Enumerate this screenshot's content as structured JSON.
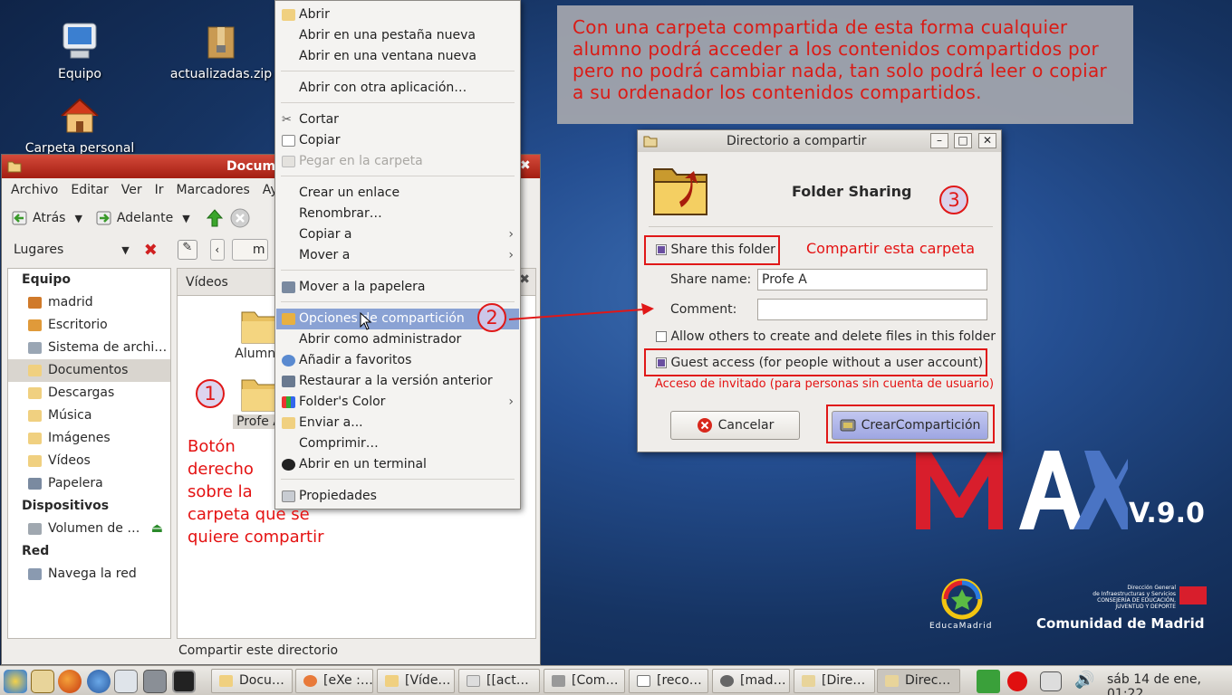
{
  "desktop": {
    "icons": [
      {
        "label": "Equipo"
      },
      {
        "label": "actualizadas.zip"
      },
      {
        "label": "Carpeta personal"
      }
    ],
    "brand": {
      "max_logo": "MAX",
      "max_version": "V.9.0",
      "educamadrid": "EducaMadrid",
      "cam_line1": "Dirección General",
      "cam_line2": "de Infraestructuras y Servicios",
      "cam_line3": "CONSEJERÍA DE EDUCACIÓN,",
      "cam_line4": "JUVENTUD Y DEPORTE",
      "cam_name": "Comunidad de Madrid"
    }
  },
  "file_manager": {
    "title": "Document",
    "menu": [
      "Archivo",
      "Editar",
      "Ver",
      "Ir",
      "Marcadores",
      "Ayu"
    ],
    "toolbar": {
      "back": "Atrás",
      "forward": "Adelante"
    },
    "places_label": "Lugares",
    "path_button": "m",
    "sidebar": {
      "sections": [
        {
          "header": "Equipo",
          "items": [
            "madrid",
            "Escritorio",
            "Sistema de archi…",
            "Documentos",
            "Descargas",
            "Música",
            "Imágenes",
            "Vídeos",
            "Papelera"
          ]
        },
        {
          "header": "Dispositivos",
          "items": [
            "Volumen de …"
          ]
        },
        {
          "header": "Red",
          "items": [
            "Navega la red"
          ]
        }
      ]
    },
    "pane_tab": "Vídeos",
    "folders": [
      "Alumno",
      "Profe A"
    ],
    "status": "Compartir este directorio"
  },
  "context_menu": {
    "items": [
      {
        "label": "Abrir"
      },
      {
        "label": "Abrir en una pestaña nueva"
      },
      {
        "label": "Abrir en una ventana nueva"
      },
      {
        "label": "Abrir con otra aplicación…"
      },
      {
        "label": "Cortar"
      },
      {
        "label": "Copiar"
      },
      {
        "label": "Pegar en la carpeta"
      },
      {
        "label": "Crear un enlace"
      },
      {
        "label": "Renombrar…"
      },
      {
        "label": "Copiar a"
      },
      {
        "label": "Mover a"
      },
      {
        "label": "Mover a la papelera"
      },
      {
        "label": "Opciones de compartición"
      },
      {
        "label": "Abrir como administrador"
      },
      {
        "label": "Añadir a favoritos"
      },
      {
        "label": "Restaurar a la versión anterior"
      },
      {
        "label": "Folder's Color"
      },
      {
        "label": "Enviar a..."
      },
      {
        "label": "Comprimir…"
      },
      {
        "label": "Abrir en un terminal"
      },
      {
        "label": "Propiedades"
      }
    ]
  },
  "dialog": {
    "title": "Directorio a compartir",
    "heading": "Folder Sharing",
    "share_this_folder": "Share this folder",
    "share_name_label": "Share name:",
    "share_name_value": "Profe A",
    "comment_label": "Comment:",
    "comment_value": "",
    "allow_others": "Allow others to create and delete files in this folder",
    "guest_access": "Guest access (for people without a user account)",
    "cancel": "Cancelar",
    "create": "CrearCompartición"
  },
  "annotations": {
    "step1": "1",
    "step2": "2",
    "step3": "3",
    "right_click": [
      "Botón",
      "derecho",
      "sobre la",
      "carpeta que se",
      "quiere compartir"
    ],
    "share_folder": "Compartir esta carpeta",
    "guest_note": "Acceso de invitado (para personas sin cuenta de usuario)",
    "info_lines": [
      "Con una carpeta compartida de esta forma cualquier",
      "alumno podrá acceder a los contenidos compartidos por",
      "pero no podrá cambiar nada, tan solo podrá leer o copiar",
      "a su ordenador los contenidos compartidos."
    ]
  },
  "taskbar": {
    "tasks": [
      "Docu…",
      "[eXe :…",
      "[Víde…",
      "[[act…",
      "[Com…",
      "[reco…",
      "[mad…",
      "[Dire…",
      "Direc…"
    ],
    "clock": "sáb 14 de ene, 01:22"
  },
  "colors": {
    "annotation_red": "#e01818",
    "highlight": "#8aa2d4",
    "titlebar_red": "#b8281a"
  }
}
